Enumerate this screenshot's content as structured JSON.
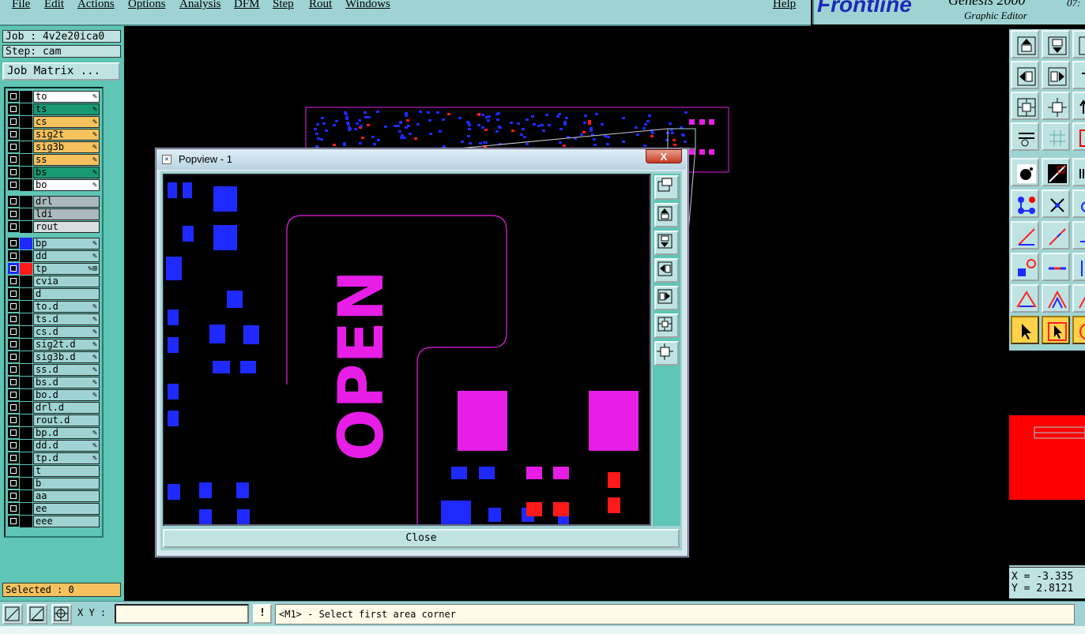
{
  "menu": {
    "items": [
      "File",
      "Edit",
      "Actions",
      "Options",
      "Analysis",
      "DFM",
      "Step",
      "Rout",
      "Windows"
    ],
    "help": "Help"
  },
  "branding": {
    "logo": "Frontline",
    "product": "Genesis 2000",
    "subtitle": "Graphic Editor",
    "clock": "07:"
  },
  "job": {
    "job_line": "Job : 4v2e20ica0",
    "step_line": "Step: cam",
    "matrix_button": "Job Matrix ..."
  },
  "layers": [
    {
      "name": "to",
      "color": "#ffffff",
      "tag": "✎"
    },
    {
      "name": "ts",
      "color": "#1a9a72",
      "tag": "✎"
    },
    {
      "name": "cs",
      "color": "#f5c25e",
      "tag": "✎"
    },
    {
      "name": "sig2t",
      "color": "#f5c25e",
      "tag": "✎"
    },
    {
      "name": "sig3b",
      "color": "#f5c25e",
      "tag": "✎"
    },
    {
      "name": "ss",
      "color": "#f5c25e",
      "tag": "✎"
    },
    {
      "name": "bs",
      "color": "#1a9a72",
      "tag": "✎"
    },
    {
      "name": "bo",
      "color": "#ffffff",
      "tag": "✎"
    },
    {
      "name": "drl",
      "color": "#a9b9bd",
      "tag": ""
    },
    {
      "name": "ldi",
      "color": "#a9b9bd",
      "tag": ""
    },
    {
      "name": "rout",
      "color": "#d8dde0",
      "tag": ""
    },
    {
      "name": "bp",
      "color": "#9fd3d3",
      "tag": "✎",
      "swatch": "#1e2aff"
    },
    {
      "name": "dd",
      "color": "#9fd3d3",
      "tag": "✎"
    },
    {
      "name": "tp",
      "color": "#9fd3d3",
      "tag": "✎⊞",
      "swatch": "#ff1a1a",
      "active": true
    },
    {
      "name": "cvia",
      "color": "#9fd3d3",
      "tag": ""
    },
    {
      "name": "d",
      "color": "#9fd3d3",
      "tag": ""
    },
    {
      "name": "to.d",
      "color": "#9fd3d3",
      "tag": "✎"
    },
    {
      "name": "ts.d",
      "color": "#9fd3d3",
      "tag": "✎"
    },
    {
      "name": "cs.d",
      "color": "#9fd3d3",
      "tag": "✎"
    },
    {
      "name": "sig2t.d",
      "color": "#9fd3d3",
      "tag": "✎"
    },
    {
      "name": "sig3b.d",
      "color": "#9fd3d3",
      "tag": "✎"
    },
    {
      "name": "ss.d",
      "color": "#9fd3d3",
      "tag": "✎"
    },
    {
      "name": "bs.d",
      "color": "#9fd3d3",
      "tag": "✎"
    },
    {
      "name": "bo.d",
      "color": "#9fd3d3",
      "tag": "✎"
    },
    {
      "name": "drl.d",
      "color": "#9fd3d3",
      "tag": ""
    },
    {
      "name": "rout.d",
      "color": "#9fd3d3",
      "tag": ""
    },
    {
      "name": "bp.d",
      "color": "#9fd3d3",
      "tag": "✎"
    },
    {
      "name": "dd.d",
      "color": "#9fd3d3",
      "tag": "✎"
    },
    {
      "name": "tp.d",
      "color": "#9fd3d3",
      "tag": "✎"
    },
    {
      "name": "t",
      "color": "#9fd3d3",
      "tag": ""
    },
    {
      "name": "b",
      "color": "#9fd3d3",
      "tag": ""
    },
    {
      "name": "aa",
      "color": "#9fd3d3",
      "tag": ""
    },
    {
      "name": "ee",
      "color": "#9fd3d3",
      "tag": ""
    },
    {
      "name": "eee",
      "color": "#9fd3d3",
      "tag": ""
    }
  ],
  "selected": "Selected : 0",
  "popview": {
    "title": "Popview - 1",
    "close_x": "X",
    "close_button": "Close",
    "board_text": "OPEN"
  },
  "coords": {
    "x": "X = -3.335",
    "y": "Y = 2.8121"
  },
  "bottom": {
    "xy_label": "X Y :",
    "xy_value": "",
    "warn": "!",
    "message": "<M1> - Select first area corner"
  },
  "colors": {
    "panel": "#9fd3d3",
    "panel_dark": "#5fc5b5",
    "pad_blue": "#1e2aff",
    "pad_magenta": "#e61ee6",
    "pad_red": "#ff1a1a"
  }
}
